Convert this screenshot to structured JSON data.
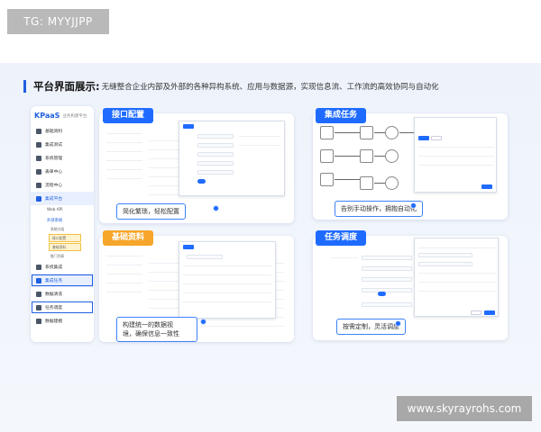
{
  "watermarks": {
    "top": "TG: MYYJJPP",
    "bottom": "www.skyrayrohs.com"
  },
  "heading": {
    "title": "平台界面展示:",
    "subtitle": "无缝整合企业内部及外部的各种异构系统、应用与数据源，实现信息流、工作流的高效协同与自动化"
  },
  "sidebar": {
    "logo": "KPaaS",
    "logo_sub": "业务构建平台",
    "items": [
      {
        "label": "基础资料"
      },
      {
        "label": "集成测试"
      },
      {
        "label": "系统管理"
      },
      {
        "label": "表单中心"
      },
      {
        "label": "流程中心"
      },
      {
        "label": "集成平台"
      }
    ],
    "sub_items": [
      {
        "label": "Web API"
      },
      {
        "label": "外部系统"
      }
    ],
    "sub2_items": [
      {
        "label": "系统分组"
      },
      {
        "label": "接口配置"
      },
      {
        "label": "基础资料"
      },
      {
        "label": "推门列表"
      }
    ],
    "bottom_items": [
      {
        "label": "系统集成"
      },
      {
        "label": "集成任务"
      },
      {
        "label": "数据清洗"
      },
      {
        "label": "任务调度"
      },
      {
        "label": "数据建模"
      }
    ]
  },
  "cards": {
    "interface": {
      "tag": "接口配置",
      "caption": "简化繁琐，轻松配置"
    },
    "integration": {
      "tag": "集成任务",
      "caption": "告别手动操作，拥抱自动化"
    },
    "basic": {
      "tag": "基础资料",
      "caption": "构建统一的数据视\n境，确保信息一致性"
    },
    "schedule": {
      "tag": "任务调度",
      "caption": "按需定制，灵活调度"
    }
  },
  "colors": {
    "accent": "#1f6bff",
    "orange": "#f6a62a",
    "heading_bar": "#1f5fe0"
  }
}
